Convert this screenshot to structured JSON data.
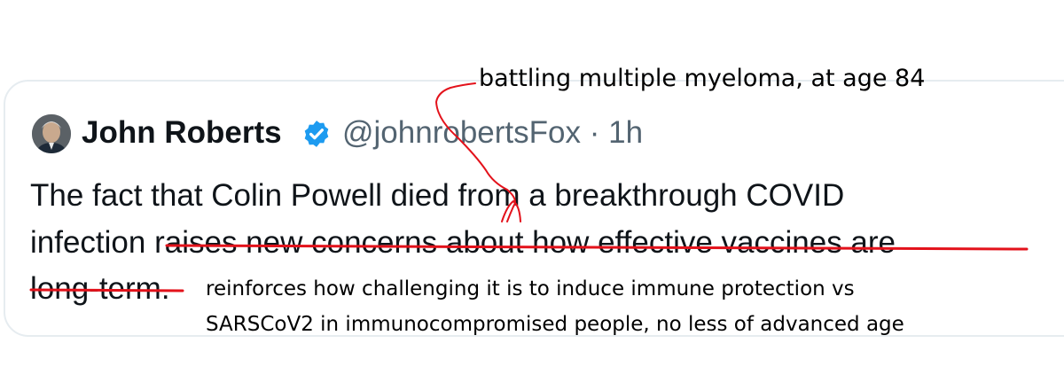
{
  "tweet": {
    "author_name": "John Roberts",
    "handle": "@johnrobertsFox",
    "separator": "·",
    "time": "1h",
    "text_line1": "The fact that Colin Powell died from a breakthrough COVID",
    "text_line2_plain": "infection",
    "text_line2_struck": " raises new concerns about how effective vaccines are",
    "text_line3_struck": "long-term",
    "text_line3_end": "."
  },
  "annotations": {
    "insert_note": "battling multiple myeloma, at age 84",
    "replacement_line1": "reinforces how challenging it is to induce immune protection vs",
    "replacement_line2": "SARSCoV2 in immunocompromised people, no less of advanced age"
  },
  "icons": {
    "verified": "verified-badge-icon",
    "avatar": "avatar-photo"
  },
  "colors": {
    "verified_blue": "#1d9bf0",
    "annotation_red": "#e3121b",
    "text_dark": "#0f1419",
    "text_muted": "#536471",
    "card_border": "#e6ecf0"
  }
}
